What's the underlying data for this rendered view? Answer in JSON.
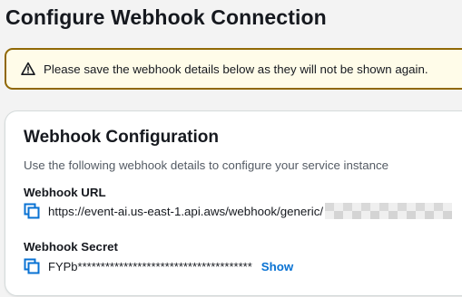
{
  "page": {
    "title": "Configure Webhook Connection"
  },
  "alert": {
    "icon": "warning-icon",
    "message": "Please save the webhook details below as they will not be shown again.",
    "colors": {
      "background": "#fffce9",
      "border": "#906806"
    }
  },
  "card": {
    "title": "Webhook Configuration",
    "description": "Use the following webhook details to configure your service instance",
    "url": {
      "label": "Webhook URL",
      "value": "https://event-ai.us-east-1.api.aws/webhook/generic/",
      "copy_icon": "copy-icon"
    },
    "secret": {
      "label": "Webhook Secret",
      "value": "FYPb**************************************",
      "show_label": "Show",
      "copy_icon": "copy-icon"
    }
  },
  "colors": {
    "accent": "#0972d3",
    "text": "#16191f",
    "muted_text": "#545b64"
  }
}
